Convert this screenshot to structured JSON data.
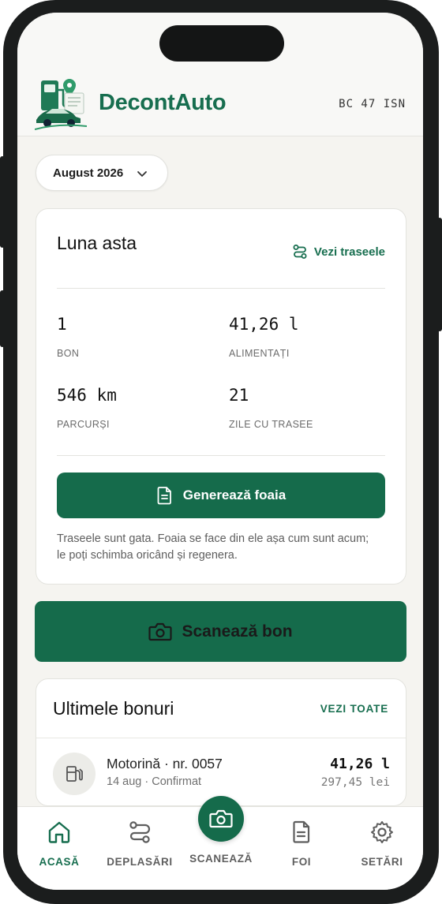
{
  "header": {
    "app_name": "DecontAuto",
    "plate": "BC 47 ISN"
  },
  "month_selector": {
    "value": "August 2026"
  },
  "month_card": {
    "title": "Luna asta",
    "routes_link": "Vezi traseele",
    "stats": [
      {
        "value": "1",
        "label": "BON"
      },
      {
        "value": "41,26 l",
        "label": "ALIMENTAȚI"
      },
      {
        "value": "546 km",
        "label": "PARCURȘI"
      },
      {
        "value": "21",
        "label": "ZILE CU TRASEE"
      }
    ],
    "generate_button": "Generează foaia",
    "note": "Traseele sunt gata. Foaia se face din ele așa cum sunt acum; le poți schimba oricând și regenera."
  },
  "scan_button": "Scanează bon",
  "receipts": {
    "title": "Ultimele bonuri",
    "see_all": "VEZI TOATE",
    "items": [
      {
        "name": "Motorină · nr. 0057",
        "meta": "14 aug · Confirmat",
        "liters": "41,26 l",
        "price": "297,45 lei"
      }
    ]
  },
  "tabs": [
    {
      "label": "ACASĂ",
      "icon": "home-icon",
      "active": true
    },
    {
      "label": "DEPLASĂRI",
      "icon": "route-icon",
      "active": false
    },
    {
      "label": "SCANEAZĂ",
      "icon": "camera-icon",
      "active": false
    },
    {
      "label": "FOI",
      "icon": "document-icon",
      "active": false
    },
    {
      "label": "SETĂRI",
      "icon": "gear-icon",
      "active": false
    }
  ],
  "colors": {
    "accent": "#176e4f",
    "button": "#156b4b",
    "background": "#f5f4f0"
  }
}
